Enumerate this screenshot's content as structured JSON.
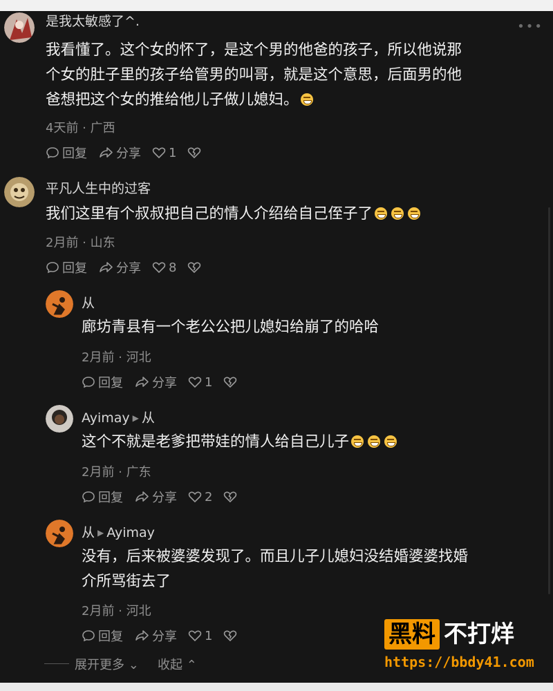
{
  "comments": [
    {
      "name": "是我太敏感了^.",
      "body_lines": [
        "我看懂了。这个女的怀了，是这个男的他爸的孩子，所以他说那",
        "个女的肚子里的孩子给管男的叫哥，就是这个意思，后面男的他",
        "爸想把这个女的推给他儿子做儿媳妇。"
      ],
      "emoji_count": 1,
      "meta": "4天前 · 广西",
      "reply_label": "回复",
      "share_label": "分享",
      "likes": "1"
    },
    {
      "name": "平凡人生中的过客",
      "body_lines": [
        "我们这里有个叔叔把自己的情人介绍给自己侄子了"
      ],
      "emoji_count": 3,
      "meta": "2月前 · 山东",
      "reply_label": "回复",
      "share_label": "分享",
      "likes": "8"
    },
    {
      "name": "从",
      "body_lines": [
        "廊坊青县有一个老公公把儿媳妇给崩了的哈哈"
      ],
      "emoji_count": 0,
      "meta": "2月前 · 河北",
      "reply_label": "回复",
      "share_label": "分享",
      "likes": "1"
    },
    {
      "name": "Ayimay",
      "reply_to": "从",
      "body_lines": [
        "这个不就是老爹把带娃的情人给自己儿子"
      ],
      "emoji_count": 3,
      "meta": "2月前 · 广东",
      "reply_label": "回复",
      "share_label": "分享",
      "likes": "2"
    },
    {
      "name": "从",
      "reply_to": "Ayimay",
      "body_lines": [
        "没有，后来被婆婆发现了。而且儿子儿媳妇没结婚婆婆找婚",
        "介所骂街去了"
      ],
      "emoji_count": 0,
      "meta": "2月前 · 河北",
      "reply_label": "回复",
      "share_label": "分享",
      "likes": "1"
    }
  ],
  "footer": {
    "expand_label": "展开更多",
    "collapse_label": "收起"
  },
  "watermark": {
    "badge": "黑料",
    "text": "不打烊",
    "url": "https://bbdy41.com"
  },
  "icons": {
    "reply": "comment-bubble-icon",
    "share": "share-arrow-icon",
    "like": "heart-icon",
    "dislike": "broken-heart-icon",
    "more": "more-dots-icon"
  },
  "colors": {
    "background": "#161616",
    "text": "#f0f0f0",
    "meta": "#8f8f8f",
    "watermark_accent": "#f39800"
  }
}
